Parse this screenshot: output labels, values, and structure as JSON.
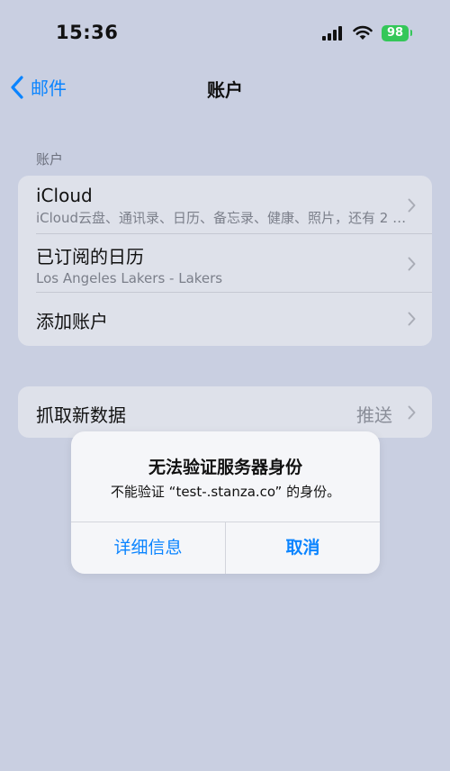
{
  "status_bar": {
    "time": "15:36",
    "battery": "98",
    "battery_color": "#34c759"
  },
  "nav": {
    "back_label": "邮件",
    "title": "账户"
  },
  "accounts_section": {
    "header": "账户",
    "rows": [
      {
        "title": "iCloud",
        "subtitle": "iCloud云盘、通讯录、日历、备忘录、健康、照片，还有 2 个…"
      },
      {
        "title": "已订阅的日历",
        "subtitle": "Los Angeles Lakers - Lakers"
      },
      {
        "title": "添加账户"
      }
    ]
  },
  "fetch_section": {
    "title": "抓取新数据",
    "value": "推送"
  },
  "alert": {
    "title": "无法验证服务器身份",
    "message": "不能验证 “test-.stanza.co” 的身份。",
    "details_button": "详细信息",
    "cancel_button": "取消"
  },
  "colors": {
    "accent": "#0a84ff",
    "background": "#c9cfe1"
  }
}
